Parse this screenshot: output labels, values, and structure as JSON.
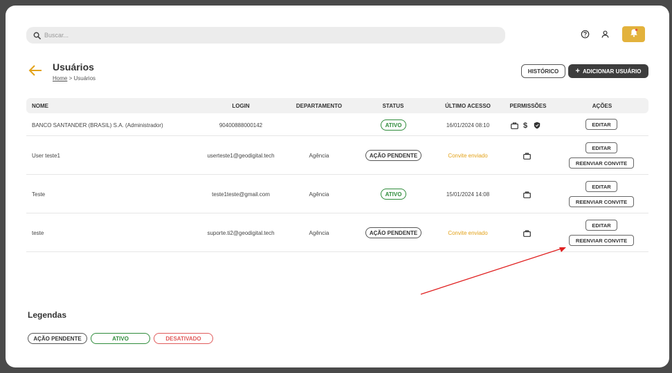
{
  "search": {
    "placeholder": "Buscar..."
  },
  "header": {
    "title": "Usuários",
    "breadcrumb_home": "Home",
    "breadcrumb_sep": " > ",
    "breadcrumb_current": "Usuários"
  },
  "actions": {
    "history": "HISTÓRICO",
    "add_user": "ADICIONAR USUÁRIO"
  },
  "table": {
    "columns": [
      "NOME",
      "LOGIN",
      "DEPARTAMENTO",
      "STATUS",
      "ÚLTIMO ACESSO",
      "PERMISSÕES",
      "AÇÕES"
    ],
    "rows": [
      {
        "name": "BANCO SANTANDER (BRASIL) S.A. (Administrador)",
        "login": "90400888000142",
        "department": "",
        "status": "ATIVO",
        "last_access": "16/01/2024 08:10",
        "edit": "EDITAR"
      },
      {
        "name": "User teste1",
        "login": "userteste1@geodigital.tech",
        "department": "Agência",
        "status": "AÇÃO PENDENTE",
        "last_access": "Convite enviado",
        "edit": "EDITAR",
        "resend": "REENVIAR CONVITE"
      },
      {
        "name": "Teste",
        "login": "teste1teste@gmail.com",
        "department": "Agência",
        "status": "ATIVO",
        "last_access": "15/01/2024 14:08",
        "edit": "EDITAR",
        "resend": "REENVIAR CONVITE"
      },
      {
        "name": "teste",
        "login": "suporte.ti2@geodigital.tech",
        "department": "Agência",
        "status": "AÇÃO PENDENTE",
        "last_access": "Convite enviado",
        "edit": "EDITAR",
        "resend": "REENVIAR CONVITE"
      }
    ]
  },
  "legend": {
    "title": "Legendas",
    "pending": "AÇÃO PENDENTE",
    "active": "ATIVO",
    "disabled": "DESATIVADO"
  },
  "icons": {
    "search": "search-icon",
    "help": "help-icon",
    "user": "user-icon",
    "bell": "bell-icon",
    "back": "back-arrow-icon",
    "briefcase": "briefcase-icon",
    "dollar": "dollar-icon",
    "shield": "shield-icon"
  },
  "colors": {
    "accent": "#e3b23c",
    "active": "#2e8b3a",
    "disabled": "#e05a5a",
    "invite": "#e3a21a",
    "annotation": "#e02020"
  }
}
